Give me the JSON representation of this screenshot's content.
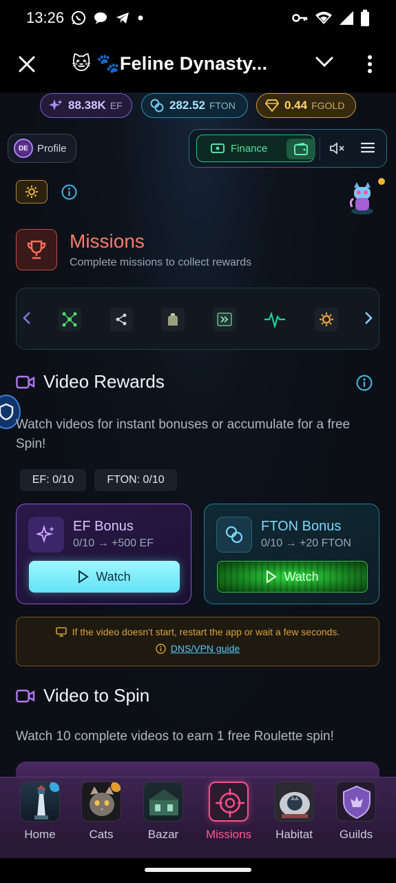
{
  "status_bar": {
    "time": "13:26"
  },
  "app_bar": {
    "title": "🐱 🐾Feline Dynasty..."
  },
  "currencies": {
    "ef": {
      "value": "88.38K",
      "unit": "EF"
    },
    "fton": {
      "value": "282.52",
      "unit": "FTON"
    },
    "fgold": {
      "value": "0.44",
      "unit": "FGOLD"
    }
  },
  "profile": {
    "initials": "DE",
    "label": "Profile"
  },
  "toolbar": {
    "finance_label": "Finance"
  },
  "missions": {
    "title": "Missions",
    "subtitle": "Complete missions to collect rewards"
  },
  "video_rewards": {
    "title": "Video Rewards",
    "description": "Watch videos for instant bonuses or accumulate for a free Spin!",
    "counters": {
      "ef": "EF: 0/10",
      "fton": "FTON: 0/10"
    },
    "ef_card": {
      "title": "EF Bonus",
      "subtitle": "0/10 → +500 EF",
      "button": "Watch"
    },
    "fton_card": {
      "title": "FTON Bonus",
      "subtitle": "0/10 → +20 FTON",
      "button": "Watch"
    },
    "warning": {
      "text": "If the video doesn't start, restart the app or wait a few seconds.",
      "link": "DNS/VPN guide"
    }
  },
  "video_to_spin": {
    "title": "Video to Spin",
    "description": "Watch 10 complete videos to earn 1 free Roulette spin!"
  },
  "bottom_nav": [
    {
      "label": "Home"
    },
    {
      "label": "Cats"
    },
    {
      "label": "Bazar"
    },
    {
      "label": "Missions"
    },
    {
      "label": "Habitat"
    },
    {
      "label": "Guilds"
    }
  ],
  "colors": {
    "accent_mission": "#ff7a6a",
    "active_nav": "#ff5a8f",
    "finance": "#53e0a8"
  }
}
